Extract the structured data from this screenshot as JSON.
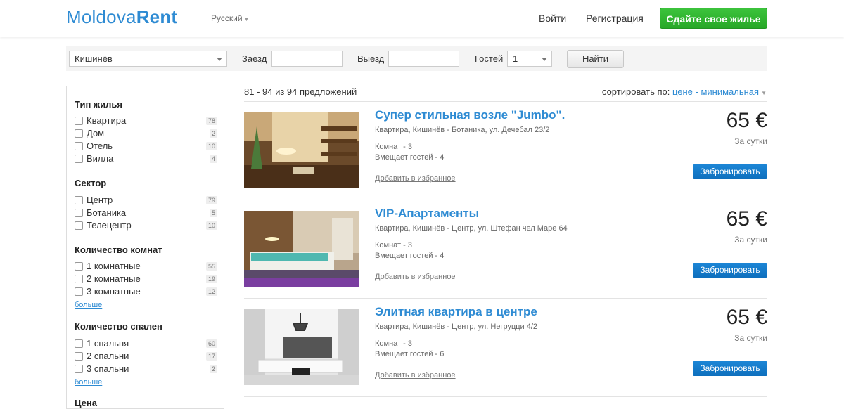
{
  "header": {
    "logo_part1": "Moldova",
    "logo_part2": "Rent",
    "language": "Русский",
    "login": "Войти",
    "register": "Регистрация",
    "list_property": "Сдайте свое жилье",
    "accent_color": "#2e8bd3",
    "cta_color": "#2fb52f"
  },
  "search": {
    "city": "Кишинёв",
    "checkin_label": "Заезд",
    "checkin_value": "",
    "checkout_label": "Выезд",
    "checkout_value": "",
    "guests_label": "Гостей",
    "guests_value": "1",
    "find_button": "Найти"
  },
  "filters": {
    "type": {
      "title": "Тип жилья",
      "items": [
        {
          "label": "Квартира",
          "count": "78"
        },
        {
          "label": "Дом",
          "count": "2"
        },
        {
          "label": "Отель",
          "count": "10"
        },
        {
          "label": "Вилла",
          "count": "4"
        }
      ]
    },
    "sector": {
      "title": "Сектор",
      "items": [
        {
          "label": "Центр",
          "count": "79"
        },
        {
          "label": "Ботаника",
          "count": "5"
        },
        {
          "label": "Телецентр",
          "count": "10"
        }
      ]
    },
    "rooms": {
      "title": "Количество комнат",
      "items": [
        {
          "label": "1 комнатные",
          "count": "55"
        },
        {
          "label": "2 комнатные",
          "count": "19"
        },
        {
          "label": "3 комнатные",
          "count": "12"
        }
      ],
      "more": "больше"
    },
    "bedrooms": {
      "title": "Количество спален",
      "items": [
        {
          "label": "1 спальня",
          "count": "60"
        },
        {
          "label": "2 спальни",
          "count": "17"
        },
        {
          "label": "3 спальни",
          "count": "2"
        }
      ],
      "more": "больше"
    },
    "price": {
      "title": "Цена"
    }
  },
  "results": {
    "count_text": "81 - 94 из 94 предложений",
    "sort_label": "сортировать по:",
    "sort_value": "цене - минимальная"
  },
  "listings": [
    {
      "title": "Супер стильная возле \"Jumbo\".",
      "address": "Квартира, Кишинёв - Ботаника, ул. Дечебал 23/2",
      "rooms": "Комнат - 3",
      "guests": "Вмещает гостей - 4",
      "favorite": "Добавить в избранное",
      "price": "65 €",
      "per_day": "За сутки",
      "book": "Забронировать"
    },
    {
      "title": "VIP-Апартаменты",
      "address": "Квартира, Кишинёв - Центр, ул. Штефан чел Маре 64",
      "rooms": "Комнат - 3",
      "guests": "Вмещает гостей - 4",
      "favorite": "Добавить в избранное",
      "price": "65 €",
      "per_day": "За сутки",
      "book": "Забронировать"
    },
    {
      "title": "Элитная квартира в центре",
      "address": "Квартира, Кишинёв - Центр, ул. Негруцци 4/2",
      "rooms": "Комнат - 3",
      "guests": "Вмещает гостей - 6",
      "favorite": "Добавить в избранное",
      "price": "65 €",
      "per_day": "За сутки",
      "book": "Забронировать"
    }
  ]
}
